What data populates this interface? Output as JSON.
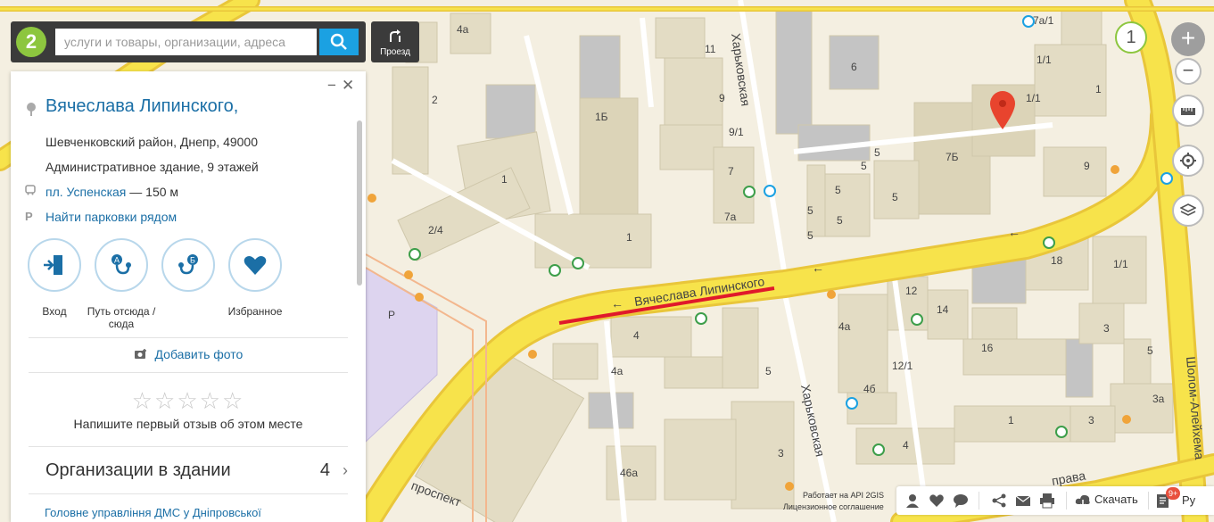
{
  "search": {
    "placeholder": "услуги и товары, организации, адреса",
    "logo": "2",
    "route_label": "Проезд"
  },
  "card": {
    "title": "Вячеслава Липинского,",
    "district": "Шевченковский район, Днепр, 49000",
    "building": "Административное здание, 9 этажей",
    "stop_name": "пл. Успенская",
    "stop_distance": "— 150 м",
    "parking": "Найти парковки рядом",
    "actions": [
      {
        "label": "Вход",
        "icon": "entrance-icon"
      },
      {
        "label": "Путь отсюда / сюда",
        "icon": "route-icon"
      },
      {
        "label": "Избранное",
        "icon": "heart-icon"
      }
    ],
    "add_photo": "Добавить фото",
    "review_prompt": "Напишите первый отзыв об этом месте",
    "orgs_label": "Организации в здании",
    "orgs_count": "4",
    "cut_text": "Головне управління ДМС у Дніпровської"
  },
  "map": {
    "streets": [
      "Вячеслава Липинского",
      "Харьковская",
      "Харьковская",
      "Шолом-Алейхема",
      "проспект",
      "права"
    ],
    "labels": {
      "b1": "4а",
      "b2": "2",
      "b3": "1",
      "b4": "2/4",
      "b5": "1Б",
      "b6": "11",
      "b7": "9",
      "b8": "9/1",
      "b9": "7",
      "b10": "7а",
      "b11": "1",
      "b12": "6",
      "b13": "7Б",
      "b14": "5",
      "b15": "5",
      "b16": "5",
      "b17": "5",
      "b18": "5",
      "b19": "5",
      "b20": "5",
      "b21": "1/1",
      "b22": "1/1",
      "b23": "1",
      "b24": "9",
      "b25": "7а/1",
      "b26": "18",
      "b27": "1/1",
      "b28": "12",
      "b29": "14",
      "b30": "4а",
      "b31": "16",
      "b32": "3",
      "b33": "12/1",
      "b34": "4б",
      "b35": "5",
      "b36": "4",
      "b37": "4а",
      "b38": "5",
      "b39": "3",
      "b40": "4",
      "b41": "1",
      "b42": "3",
      "b43": "3а",
      "b44": "46а",
      "b45": "Р"
    },
    "marker_count": "1"
  },
  "bottom": {
    "download": "Скачать",
    "lang": "Ру",
    "badge": "9+",
    "api": "Работает на API 2GIS",
    "license": "Лицензионное соглашение"
  },
  "colors": {
    "accent": "#1ba1e2",
    "road": "#f7e34b",
    "road_edge": "#e9c63a",
    "route": "#e0192b",
    "pin": "#e8442e",
    "logo": "#8dc63f"
  }
}
